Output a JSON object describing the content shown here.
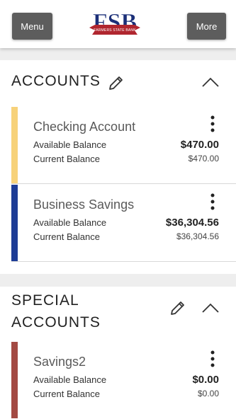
{
  "header": {
    "menu_label": "Menu",
    "more_label": "More",
    "logo_letters": "FSB",
    "logo_banner": "FARMERS STATE BANK"
  },
  "sections": [
    {
      "title": "ACCOUNTS",
      "accounts": [
        {
          "name": "Checking Account",
          "available_label": "Available Balance",
          "available": "$470.00",
          "current_label": "Current Balance",
          "current": "$470.00",
          "color": "#f7d27a"
        },
        {
          "name": "Business Savings",
          "available_label": "Available Balance",
          "available": "$36,304.56",
          "current_label": "Current Balance",
          "current": "$36,304.56",
          "color": "#1d3c96"
        }
      ]
    },
    {
      "title_line1": "SPECIAL",
      "title_line2": "ACCOUNTS",
      "accounts": [
        {
          "name": "Savings2",
          "available_label": "Available Balance",
          "available": "$0.00",
          "current_label": "Current Balance",
          "current": "$0.00",
          "color": "#a34a43"
        }
      ]
    }
  ],
  "icons": {
    "edit": "pencil-icon",
    "collapse": "chevron-up-icon",
    "actions": "more-vertical-icon"
  }
}
